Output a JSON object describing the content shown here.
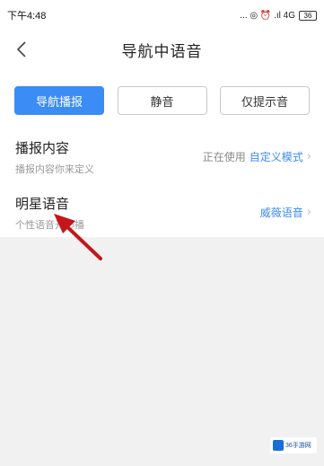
{
  "status_bar": {
    "time": "下午4:48",
    "indicators": "... ◎ ⏰ .ıl 4G",
    "battery": "36"
  },
  "nav": {
    "title": "导航中语音",
    "back_icon": "chevron-left-icon"
  },
  "modes": {
    "items": [
      {
        "label": "导航播报",
        "active": true
      },
      {
        "label": "静音",
        "active": false
      },
      {
        "label": "仅提示音",
        "active": false
      }
    ]
  },
  "settings": {
    "broadcast_content": {
      "title": "播报内容",
      "subtitle": "播报内容你来定义",
      "status_prefix": "正在使用",
      "status_link": "自定义模式"
    },
    "celebrity_voice": {
      "title": "明星语音",
      "subtitle": "个性语音开心播",
      "status_link": "威薇语音"
    }
  },
  "colors": {
    "accent": "#3b8cf5",
    "annotation_arrow": "#c4161c"
  },
  "watermark": {
    "text": "36手游网"
  }
}
